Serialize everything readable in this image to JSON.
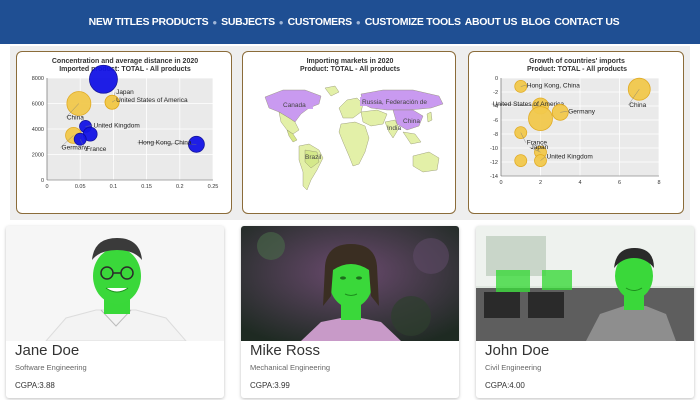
{
  "nav": {
    "items": [
      "NEW TITLES PRODUCTS",
      "SUBJECTS",
      "CUSTOMERS",
      "CUSTOMIZE TOOLS",
      "ABOUT US",
      "BLOG",
      "CONTACT US"
    ]
  },
  "colors": {
    "nav_bg": "#1f4f93",
    "bubble_gold": "#f2c94c",
    "bubble_blue": "#1414e6",
    "map_land": "#e3f0a8",
    "map_highlight": "#c99af0"
  },
  "charts": {
    "bubble_map": {
      "title_line1": "Concentration and average distance in 2020",
      "title_line2": "Imported product: TOTAL - All products"
    },
    "world_map": {
      "title_line1": "Importing markets in 2020",
      "title_line2": "Product: TOTAL - All products",
      "labels": {
        "canada": "Canada",
        "russia": "Russia, Federación de",
        "china": "China",
        "india": "India",
        "brazil": "Brazil"
      }
    },
    "growth": {
      "title_line1": "Growth of countries' imports",
      "title_line2": "Product: TOTAL - All products"
    }
  },
  "chart_data": [
    {
      "type": "scatter",
      "title": "Concentration and average distance in 2020",
      "subtitle": "Imported product: TOTAL - All products",
      "xlim": [
        0,
        0.25
      ],
      "ylim": [
        0,
        8000
      ],
      "xticks": [
        "0",
        "0.05",
        "0.1",
        "0.15",
        "0.2",
        "0.25"
      ],
      "yticks": [
        "0",
        "2000",
        "4000",
        "6000",
        "8000"
      ],
      "points": [
        {
          "label": "",
          "x": 0.085,
          "y": 7900,
          "size": 14,
          "color": "blue"
        },
        {
          "label": "Japan",
          "x": 0.098,
          "y": 6100,
          "size": 7,
          "color": "gold"
        },
        {
          "label": "United States of America",
          "x": 0.098,
          "y": 6100,
          "size": 7,
          "color": "gold"
        },
        {
          "label": "China",
          "x": 0.048,
          "y": 6000,
          "size": 12,
          "color": "gold"
        },
        {
          "label": "United Kingdom",
          "x": 0.058,
          "y": 4200,
          "size": 6,
          "color": "blue"
        },
        {
          "label": "Germany",
          "x": 0.04,
          "y": 3500,
          "size": 8,
          "color": "gold"
        },
        {
          "label": "",
          "x": 0.065,
          "y": 3600,
          "size": 7,
          "color": "blue"
        },
        {
          "label": "France",
          "x": 0.05,
          "y": 3200,
          "size": 6,
          "color": "blue"
        },
        {
          "label": "Hong Kong, China",
          "x": 0.225,
          "y": 2800,
          "size": 8,
          "color": "blue"
        }
      ]
    },
    {
      "type": "scatter",
      "title": "Growth of countries' imports",
      "subtitle": "Product: TOTAL - All products",
      "xlim": [
        0,
        8
      ],
      "ylim": [
        -14,
        0
      ],
      "xticks": [
        "0",
        "2",
        "4",
        "6",
        "8"
      ],
      "yticks": [
        "0",
        "-2",
        "-4",
        "-6",
        "-8",
        "-10",
        "-12",
        "-14"
      ],
      "points": [
        {
          "label": "Hong Kong, China",
          "x": 1.0,
          "y": -1.2,
          "size": 6
        },
        {
          "label": "China",
          "x": 7.0,
          "y": -1.6,
          "size": 11
        },
        {
          "label": "United States of America",
          "x": 2.0,
          "y": -4.0,
          "size": 8
        },
        {
          "label": "",
          "x": 2.0,
          "y": -5.8,
          "size": 12
        },
        {
          "label": "Germany",
          "x": 3.0,
          "y": -4.9,
          "size": 8
        },
        {
          "label": "France",
          "x": 1.0,
          "y": -7.8,
          "size": 6
        },
        {
          "label": "Japan",
          "x": 2.0,
          "y": -10.6,
          "size": 6
        },
        {
          "label": "",
          "x": 1.0,
          "y": -11.8,
          "size": 6
        },
        {
          "label": "United Kingdom",
          "x": 2.0,
          "y": -11.8,
          "size": 6
        }
      ]
    }
  ],
  "students": [
    {
      "name": "Jane Doe",
      "major": "Software Engineering",
      "gpa": "CGPA:3.88"
    },
    {
      "name": "Mike Ross",
      "major": "Mechanical Engineering",
      "gpa": "CGPA:3.99"
    },
    {
      "name": "John Doe",
      "major": "Civil Engineering",
      "gpa": "CGPA:4.00"
    }
  ]
}
